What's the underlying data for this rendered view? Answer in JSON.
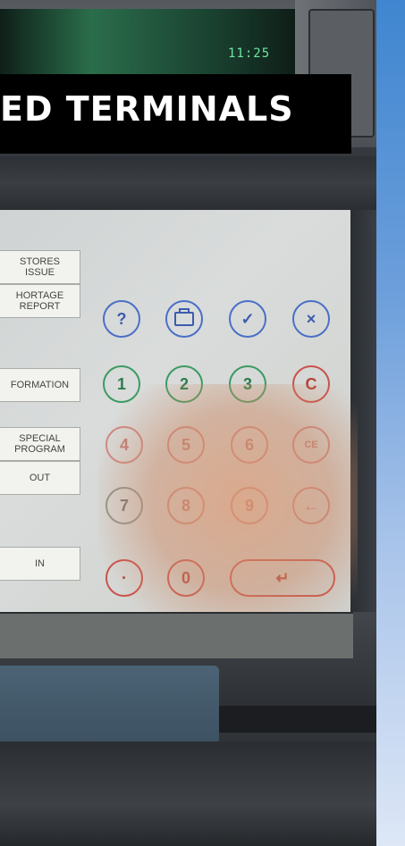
{
  "display": {
    "time": "11:25"
  },
  "banner": {
    "text": "ED TERMINALS"
  },
  "side_buttons": [
    "STORES\nISSUE",
    "HORTAGE\nREPORT",
    "FORMATION",
    "SPECIAL\nPROGRAM",
    "OUT",
    "IN"
  ],
  "keypad": {
    "row1": {
      "help": "?",
      "check": "✓",
      "cancel": "×"
    },
    "row2": {
      "k1": "1",
      "k2": "2",
      "k3": "3",
      "clear": "C"
    },
    "row3": {
      "k4": "4",
      "k5": "5",
      "k6": "6",
      "clear_entry": "CE"
    },
    "row4": {
      "k7": "7",
      "k8": "8",
      "k9": "9",
      "backspace": "←"
    },
    "row5": {
      "dot": "·",
      "k0": "0",
      "enter": "↵"
    }
  },
  "colors": {
    "sidebar_top": "#3f86d0",
    "sidebar_bottom": "#dde7f6",
    "banner_bg": "#000000",
    "display_text": "#6ce7a2"
  }
}
